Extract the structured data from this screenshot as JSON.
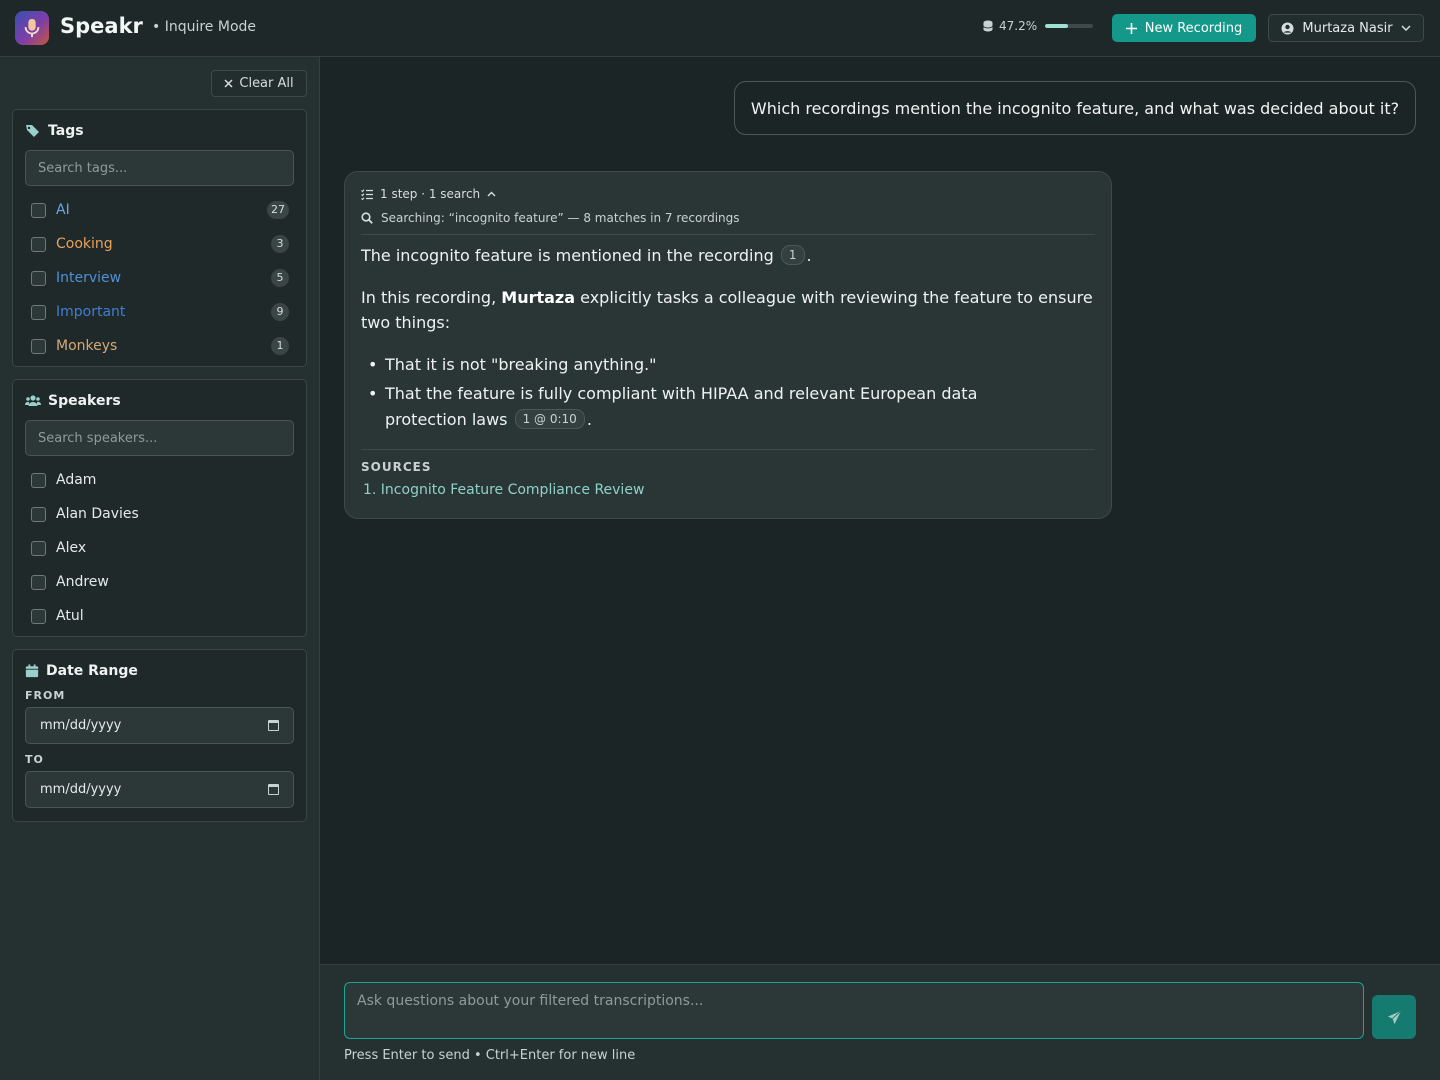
{
  "header": {
    "app_title": "Speakr",
    "mode": "• Inquire Mode",
    "storage_percent": "47.2%",
    "storage_fraction": 0.472,
    "new_recording_label": "New Recording",
    "user_name": "Murtaza Nasir"
  },
  "sidebar": {
    "clear_all_label": "Clear All",
    "tags": {
      "title": "Tags",
      "search_placeholder": "Search tags...",
      "items": [
        {
          "label": "AI",
          "count": "27",
          "color": "#6fa3e6"
        },
        {
          "label": "Cooking",
          "count": "3",
          "color": "#e9a15a"
        },
        {
          "label": "Interview",
          "count": "5",
          "color": "#4f8fd6"
        },
        {
          "label": "Important",
          "count": "9",
          "color": "#3f7fd0"
        },
        {
          "label": "Monkeys",
          "count": "1",
          "color": "#d4a978"
        }
      ]
    },
    "speakers": {
      "title": "Speakers",
      "search_placeholder": "Search speakers...",
      "items": [
        "Adam",
        "Alan Davies",
        "Alex",
        "Andrew",
        "Atul"
      ]
    },
    "date_range": {
      "title": "Date Range",
      "from_label": "FROM",
      "to_label": "TO",
      "from_value": "mm/dd/yyyy",
      "to_value": "mm/dd/yyyy"
    }
  },
  "chat": {
    "user_message": "Which recordings mention the incognito feature, and what was decided about it?",
    "answer": {
      "steps": "1 step · 1 search",
      "searching": "Searching: “incognito feature” — 8 matches in 7 recordings",
      "p1_text": "The incognito feature is mentioned in the recording",
      "p1_cite": "1",
      "p2_before": "In this recording,",
      "p2_bold": "Murtaza",
      "p2_after": "explicitly tasks a colleague with reviewing the feature to ensure two things:",
      "bullet1": "That it is not \"breaking anything.\"",
      "bullet2": "That the feature is fully compliant with HIPAA and relevant European data protection laws",
      "bullet2_cite": "1 @ 0:10",
      "sources_title": "SOURCES",
      "source1": "1. Incognito Feature Compliance Review"
    },
    "input_placeholder": "Ask questions about your filtered transcriptions...",
    "hint": "Press Enter to send • Ctrl+Enter for new line"
  }
}
